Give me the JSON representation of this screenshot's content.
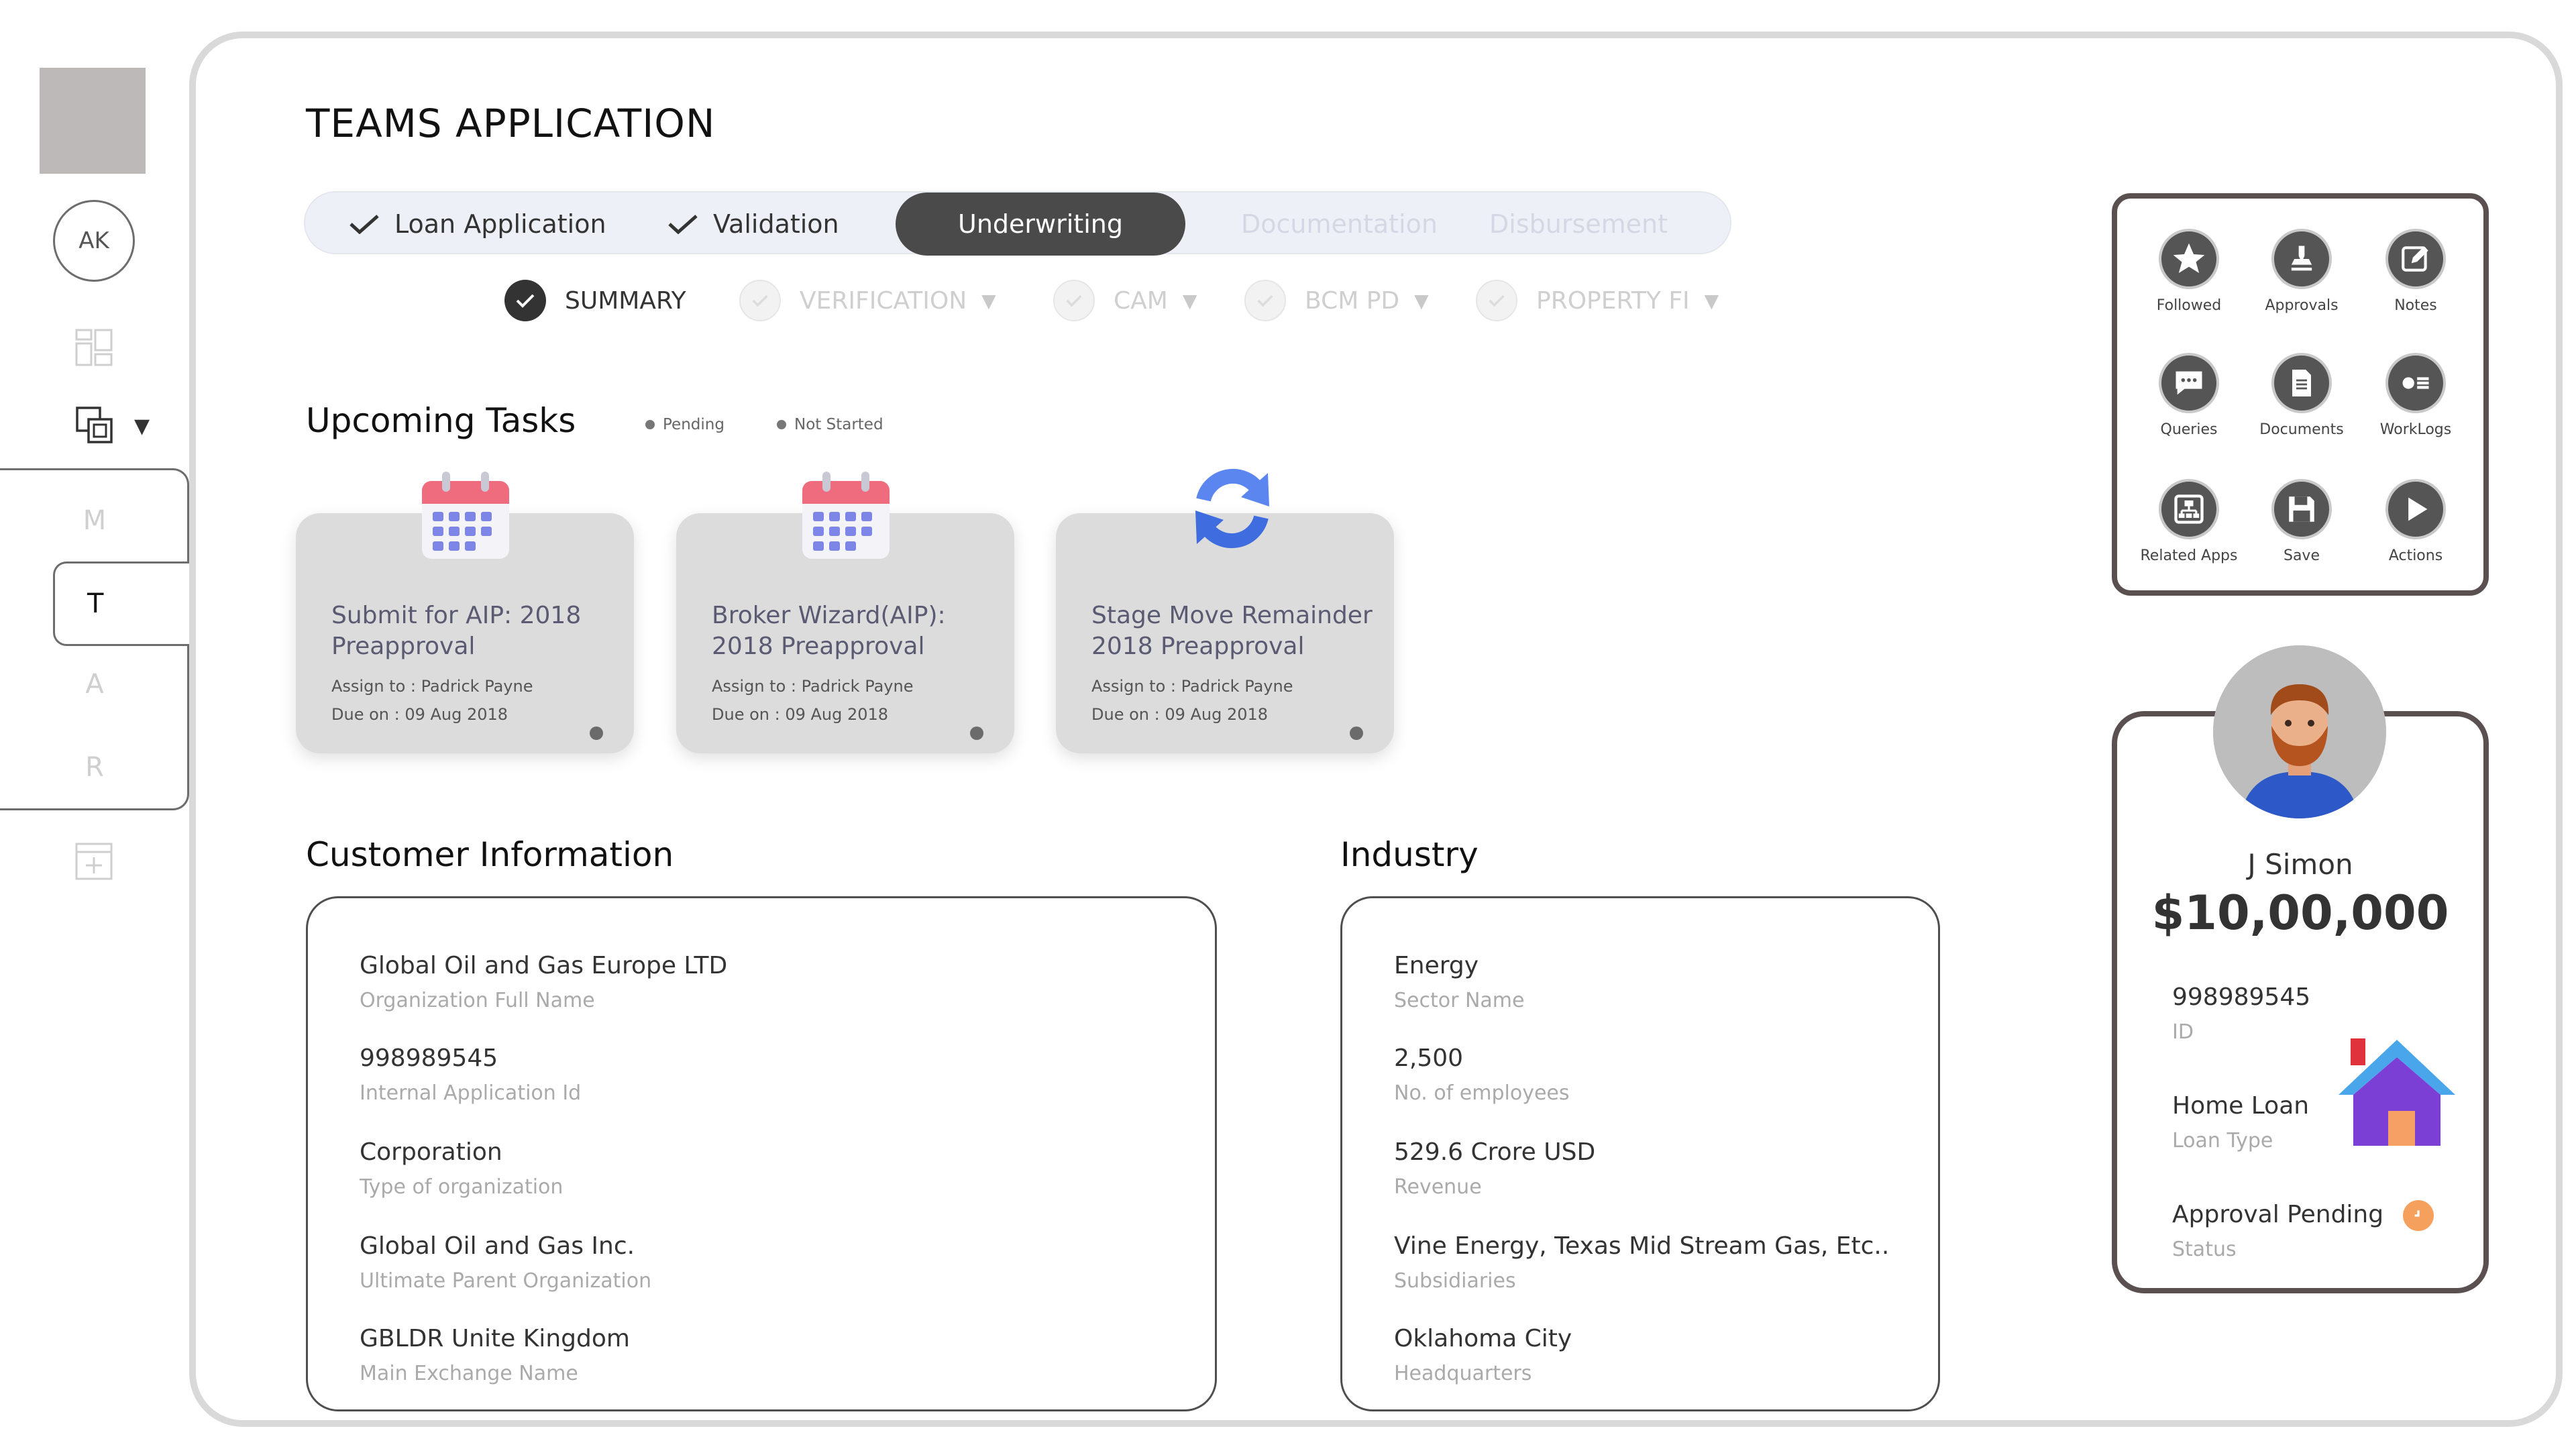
{
  "rail": {
    "avatar_initials": "AK",
    "letters": [
      "M",
      "T",
      "A",
      "R"
    ],
    "active_letter": "T"
  },
  "app_title": "TEAMS APPLICATION",
  "stepper": {
    "steps": [
      {
        "label": "Loan Application",
        "state": "done"
      },
      {
        "label": "Validation",
        "state": "done"
      },
      {
        "label": "Underwriting",
        "state": "active"
      },
      {
        "label": "Documentation",
        "state": "pending"
      },
      {
        "label": "Disbursement",
        "state": "pending"
      }
    ]
  },
  "substeps": [
    {
      "label": "SUMMARY",
      "state": "done"
    },
    {
      "label": "VERIFICATION",
      "state": "pending"
    },
    {
      "label": "CAM",
      "state": "pending"
    },
    {
      "label": "BCM PD",
      "state": "pending"
    },
    {
      "label": "PROPERTY FI",
      "state": "pending"
    }
  ],
  "upcoming": {
    "title": "Upcoming Tasks",
    "legend_pending": "Pending",
    "legend_not_started": "Not Started",
    "tasks": [
      {
        "icon": "calendar-icon",
        "title": "Submit for AIP: 2018 Preapproval",
        "assign": "Assign to : Padrick Payne",
        "due": "Due on : 09 Aug 2018"
      },
      {
        "icon": "calendar-icon",
        "title": "Broker Wizard(AIP): 2018 Preapproval",
        "assign": "Assign to : Padrick Payne",
        "due": "Due on : 09 Aug 2018"
      },
      {
        "icon": "refresh-icon",
        "title": "Stage Move Remainder 2018 Preapproval",
        "assign": "Assign to : Padrick Payne",
        "due": "Due on : 09 Aug 2018"
      }
    ]
  },
  "customer": {
    "title": "Customer Information",
    "fields": [
      {
        "value": "Global Oil and Gas Europe LTD",
        "label": "Organization Full Name"
      },
      {
        "value": "998989545",
        "label": "Internal Application Id"
      },
      {
        "value": "Corporation",
        "label": "Type of organization"
      },
      {
        "value": "Global Oil and Gas Inc.",
        "label": "Ultimate Parent Organization"
      },
      {
        "value": "GBLDR Unite Kingdom",
        "label": "Main Exchange Name"
      }
    ]
  },
  "industry": {
    "title": "Industry",
    "fields": [
      {
        "value": "Energy",
        "label": "Sector Name"
      },
      {
        "value": "2,500",
        "label": "No. of employees"
      },
      {
        "value": "529.6 Crore USD",
        "label": "Revenue"
      },
      {
        "value": "Vine Energy, Texas Mid Stream Gas, Etc..",
        "label": "Subsidiaries"
      },
      {
        "value": "Oklahoma City",
        "label": "Headquarters"
      }
    ]
  },
  "quick_actions": [
    {
      "label": "Followed",
      "icon": "star-icon"
    },
    {
      "label": "Approvals",
      "icon": "stamp-icon"
    },
    {
      "label": "Notes",
      "icon": "note-edit-icon"
    },
    {
      "label": "Queries",
      "icon": "chat-icon"
    },
    {
      "label": "Documents",
      "icon": "document-icon"
    },
    {
      "label": "WorkLogs",
      "icon": "worklog-icon"
    },
    {
      "label": "Related Apps",
      "icon": "hierarchy-icon"
    },
    {
      "label": "Save",
      "icon": "save-icon"
    },
    {
      "label": "Actions",
      "icon": "play-icon"
    }
  ],
  "profile": {
    "name": "J Simon",
    "amount": "$10,00,000",
    "id_value": "998989545",
    "id_label": "ID",
    "loan_type_value": "Home Loan",
    "loan_type_label": "Loan Type",
    "status_value": "Approval Pending",
    "status_label": "Status"
  },
  "colors": {
    "active_step": "#4a4a4a",
    "stepper_bg": "#eef0f7",
    "card_border": "#5a5050",
    "status_orange": "#f5a05c",
    "task_title": "#5a5a72"
  }
}
